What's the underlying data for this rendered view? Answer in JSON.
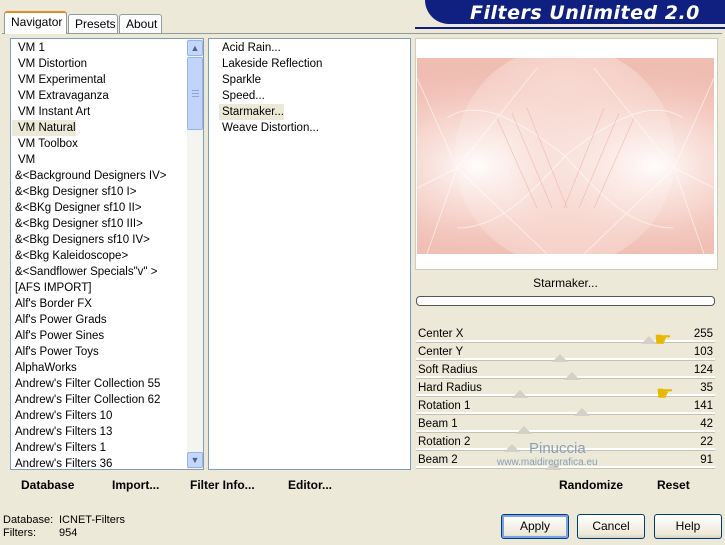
{
  "tabs": [
    {
      "label": "Navigator"
    },
    {
      "label": "Presets"
    },
    {
      "label": "About"
    }
  ],
  "banner": {
    "title": "Filters Unlimited 2.0"
  },
  "categories": [
    "VM 1",
    "VM Distortion",
    "VM Experimental",
    "VM Extravaganza",
    "VM Instant Art",
    "VM Natural",
    "VM Toolbox",
    "VM",
    "&<Background Designers IV>",
    "&<Bkg Designer sf10 I>",
    "&<BKg Designer sf10 II>",
    "&<Bkg Designer sf10 III>",
    "&<Bkg Designers sf10 IV>",
    "&<Bkg Kaleidoscope>",
    "&<Sandflower Specials\"v\" >",
    "[AFS IMPORT]",
    "Alf's Border FX",
    "Alf's Power Grads",
    "Alf's Power Sines",
    "Alf's Power Toys",
    "AlphaWorks",
    "Andrew's Filter Collection 55",
    "Andrew's Filter Collection 62",
    "Andrew's Filters 10",
    "Andrew's Filters 13",
    "Andrew's Filters 1",
    "Andrew's Filters 36"
  ],
  "selected_category": "VM Natural",
  "filters": [
    "Acid Rain...",
    "Lakeside Reflection",
    "Sparkle",
    "Speed...",
    "Starmaker...",
    "Weave Distortion..."
  ],
  "selected_filter": "Starmaker...",
  "filter_name": "Starmaker...",
  "parameters": [
    {
      "label": "Center X",
      "value": "255",
      "fraction": 1.0
    },
    {
      "label": "Center Y",
      "value": "103",
      "fraction": 0.404
    },
    {
      "label": "Soft Radius",
      "value": "124",
      "fraction": 0.486
    },
    {
      "label": "Hard Radius",
      "value": "35",
      "fraction": 0.137
    },
    {
      "label": "Rotation 1",
      "value": "141",
      "fraction": 0.553
    },
    {
      "label": "Beam 1",
      "value": "42",
      "fraction": 0.165
    },
    {
      "label": "Rotation 2",
      "value": "22",
      "fraction": 0.086
    },
    {
      "label": "Beam 2",
      "value": "91",
      "fraction": 0.357
    }
  ],
  "bottom_left": {
    "database": "Database",
    "import": "Import...",
    "filter_info": "Filter Info...",
    "editor": "Editor..."
  },
  "bottom_right": {
    "randomize": "Randomize",
    "reset": "Reset"
  },
  "status": {
    "database_label": "Database:",
    "database_value": "ICNET-Filters",
    "filters_label": "Filters:",
    "filters_value": "954"
  },
  "buttons": {
    "apply": "Apply",
    "cancel": "Cancel",
    "help": "Help"
  },
  "watermark": {
    "line1": "Pinuccia",
    "line2": "www.maidiregrafica.eu"
  },
  "colors": {
    "banner": "#102080",
    "preview_pink": "#f3c9c0",
    "selection": "#ece9d8"
  }
}
